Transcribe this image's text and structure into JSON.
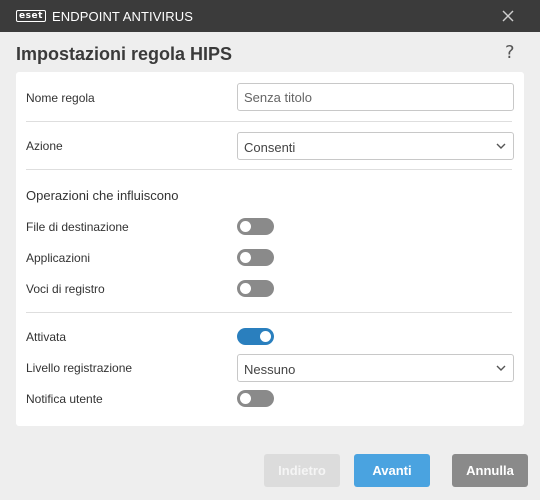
{
  "titlebar": {
    "logo_text": "eset",
    "app_title": "ENDPOINT ANTIVIRUS"
  },
  "header": {
    "title": "Impostazioni regola HIPS",
    "help": "?"
  },
  "form": {
    "rule_name": {
      "label": "Nome regola",
      "placeholder": "Senza titolo"
    },
    "action": {
      "label": "Azione",
      "value": "Consenti"
    },
    "operations": {
      "title": "Operazioni che influiscono",
      "items": [
        {
          "label": "File di destinazione",
          "enabled": false
        },
        {
          "label": "Applicazioni",
          "enabled": false
        },
        {
          "label": "Voci di registro",
          "enabled": false
        }
      ]
    },
    "enabled": {
      "label": "Attivata",
      "value": true
    },
    "log_level": {
      "label": "Livello registrazione",
      "value": "Nessuno"
    },
    "notify_user": {
      "label": "Notifica utente",
      "value": false
    }
  },
  "buttons": {
    "back": "Indietro",
    "next": "Avanti",
    "cancel": "Annulla"
  },
  "colors": {
    "titlebar": "#3b3b3b",
    "toggle_on": "#2a7fbe",
    "toggle_off": "#8a8a8a",
    "primary_button": "#4aa3e0"
  }
}
